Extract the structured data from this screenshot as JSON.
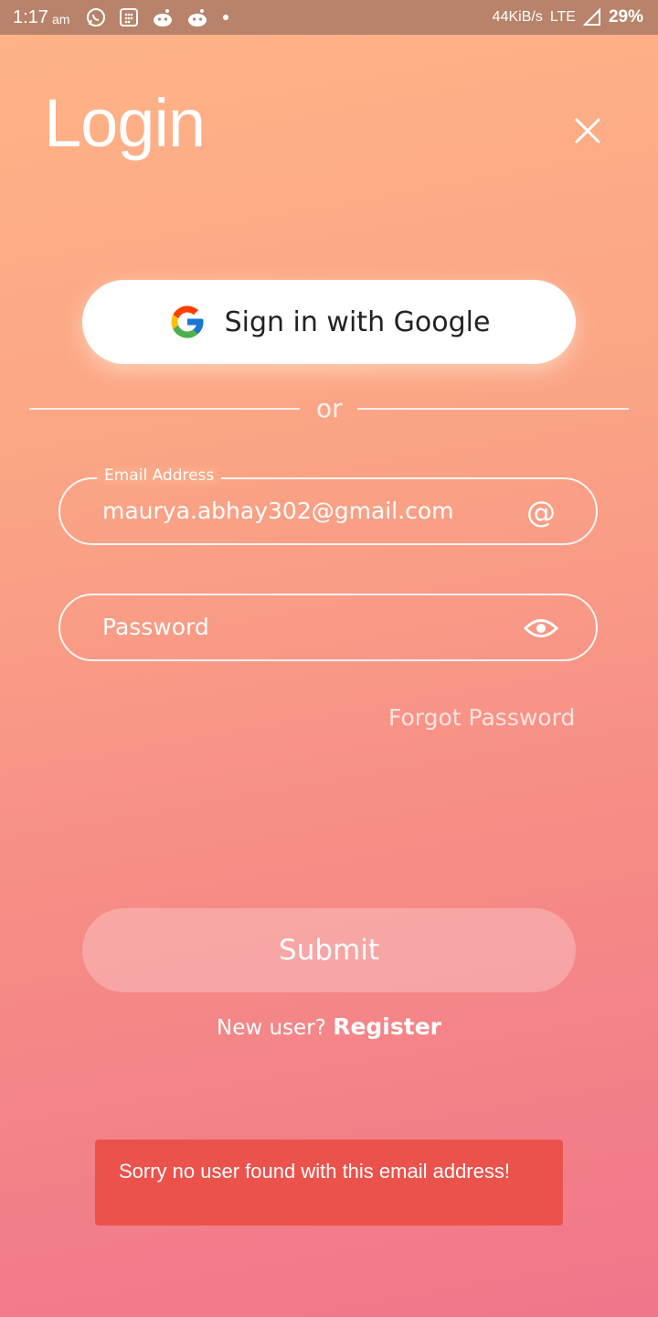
{
  "status_bar": {
    "time": "1:17",
    "ampm": "am",
    "icons": [
      "whatsapp-icon",
      "calculator-icon",
      "reddit-icon",
      "reddit-icon",
      "dot-icon"
    ],
    "network_speed": "44KiB/s",
    "network_type": "LTE",
    "battery": "29%"
  },
  "header": {
    "title": "Login",
    "close_icon": "close-icon"
  },
  "google_signin": {
    "label": "Sign in with Google",
    "icon": "google-icon"
  },
  "divider": {
    "text": "or"
  },
  "email_field": {
    "legend": "Email Address",
    "value": "maurya.abhay302@gmail.com",
    "icon": "at-icon"
  },
  "password_field": {
    "placeholder": "Password",
    "icon": "eye-icon"
  },
  "forgot_password": {
    "label": "Forgot Password"
  },
  "submit": {
    "label": "Submit"
  },
  "register": {
    "prefix": "New user?",
    "link_label": "Register"
  },
  "snackbar": {
    "message": "Sorry no user found with this email address!"
  },
  "colors": {
    "status_bar": "#b8836a",
    "gradient_top": "#ffb487",
    "gradient_bottom": "#f0768b",
    "snackbar": "#ec524c"
  }
}
